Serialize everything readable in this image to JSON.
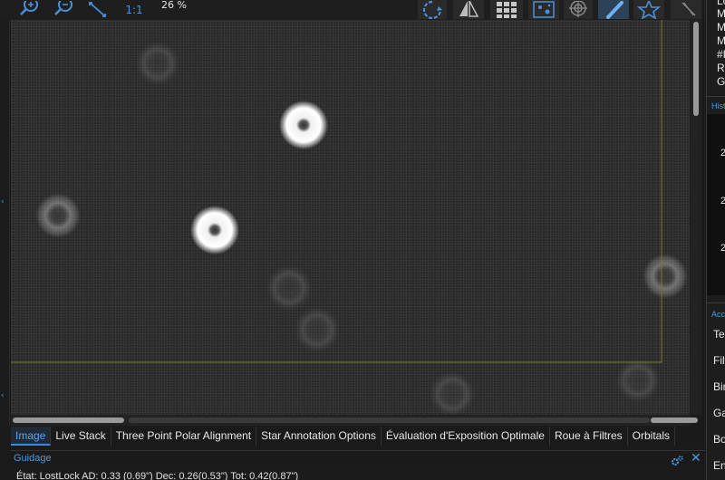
{
  "toolbar": {
    "zoom_fit_label": "1:1",
    "zoom_percent": "26 %",
    "icons": [
      "zoom-in-icon",
      "zoom-out-icon",
      "fit-to-screen-icon",
      "rotate-icon",
      "mirror-icon",
      "grid-icon",
      "star-detect-icon",
      "crosshair-icon",
      "brush-icon",
      "star-icon",
      "tools-icon"
    ],
    "accent_color": "#3c8ad8"
  },
  "tabs": [
    {
      "label": "Image",
      "active": true
    },
    {
      "label": "Live Stack"
    },
    {
      "label": "Three Point Polar Alignment"
    },
    {
      "label": "Star Annotation Options"
    },
    {
      "label": "Évaluation d'Exposition Optimale"
    },
    {
      "label": "Roue à Filtres"
    },
    {
      "label": "Orbitals"
    }
  ],
  "guide": {
    "title": "Guidage",
    "status": "État: LostLock  AD: 0.33 (0.69\")  Dec: 0.26(0.53\")  Tot: 0.42(0.87\")"
  },
  "right_panel": {
    "stats_rows": [
      "Lo",
      "M",
      "M",
      "M",
      "#I",
      "Re",
      "G"
    ],
    "histogram_header": "Hist",
    "histogram_ticks": [
      "2",
      "2",
      "2"
    ],
    "accessories_header": "Acc",
    "accessories_rows": [
      "Ter",
      "Filt",
      "Bin",
      "Ga",
      "Bo",
      "En"
    ]
  }
}
